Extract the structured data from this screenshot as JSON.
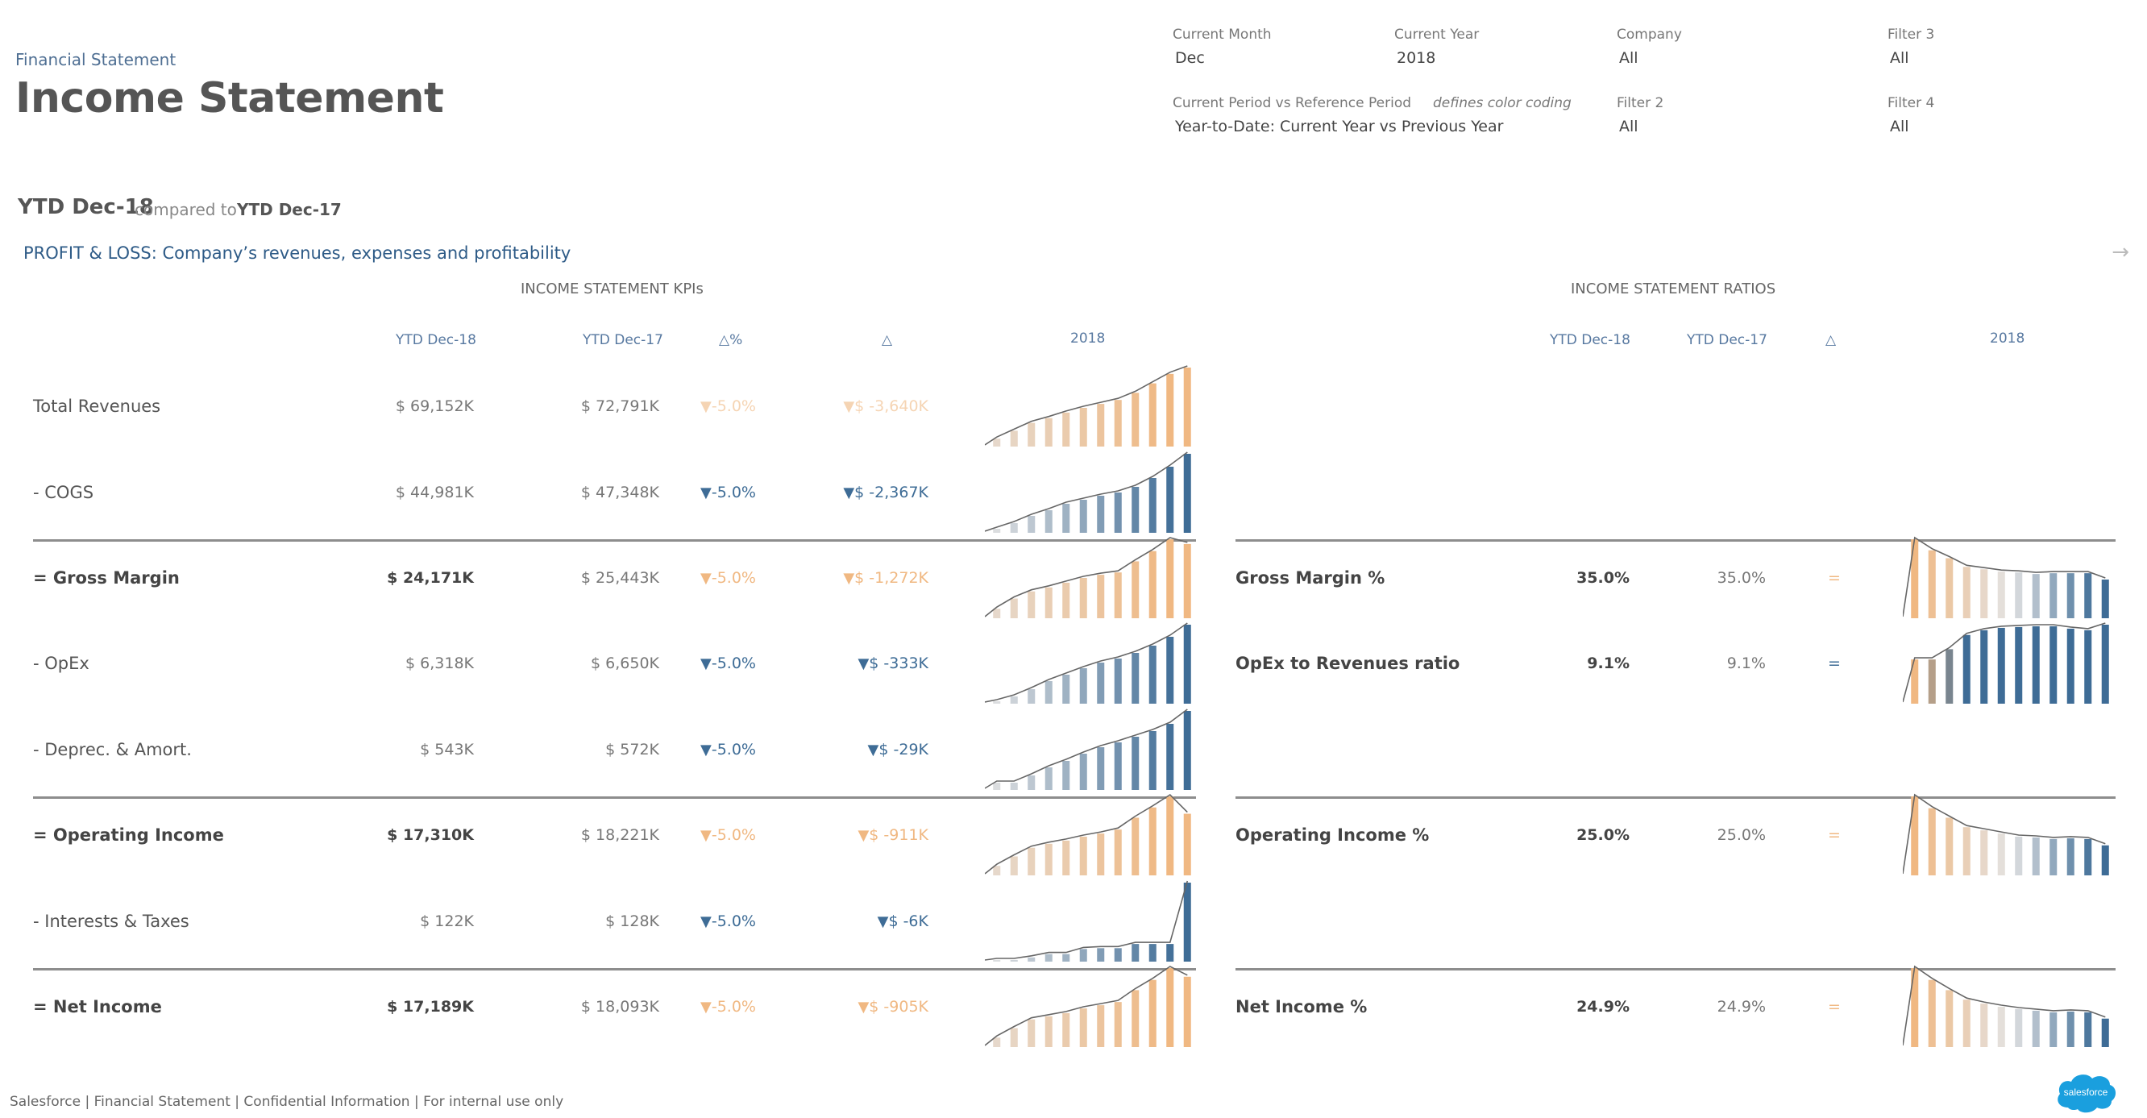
{
  "header": {
    "breadcrumb": "Financial Statement",
    "title": "Income Statement"
  },
  "filters": [
    {
      "label": "Current Month",
      "value": "Dec"
    },
    {
      "label": "Current Year",
      "value": "2018"
    },
    {
      "label": "Company",
      "value": "All"
    },
    {
      "label": "Filter 3",
      "value": "All"
    },
    {
      "label": "Current Period vs Reference Period",
      "note": "defines color coding",
      "value": "Year-to-Date: Current Year vs Previous Year"
    },
    {
      "label": "Filter 2",
      "value": "All"
    },
    {
      "label": "Filter 4",
      "value": "All"
    }
  ],
  "period": {
    "current": "YTD Dec-18",
    "compared_label": "compared to",
    "reference": "YTD Dec-17"
  },
  "section_title": "PROFIT & LOSS: Company’s revenues, expenses and profitability",
  "nav_arrow": "→",
  "kpis": {
    "title": "INCOME STATEMENT KPIs",
    "columns": [
      "YTD Dec-18",
      "YTD Dec-17",
      "△%",
      "△",
      "2018"
    ],
    "rows": [
      {
        "label": "Total Revenues",
        "bold": false,
        "cur": "$ 69,152K",
        "prev": "$ 72,791K",
        "dpct": "-5.0%",
        "dabs": "$ -3,640K",
        "color": "orange",
        "faded": true
      },
      {
        "label": "- COGS",
        "bold": false,
        "cur": "$ 44,981K",
        "prev": "$ 47,348K",
        "dpct": "-5.0%",
        "dabs": "$ -2,367K",
        "color": "blue"
      },
      {
        "label": "= Gross Margin",
        "bold": true,
        "cur": "$ 24,171K",
        "prev": "$ 25,443K",
        "dpct": "-5.0%",
        "dabs": "$ -1,272K",
        "color": "orange"
      },
      {
        "label": "- OpEx",
        "bold": false,
        "cur": "$ 6,318K",
        "prev": "$ 6,650K",
        "dpct": "-5.0%",
        "dabs": "$ -333K",
        "color": "blue"
      },
      {
        "label": "- Deprec. & Amort.",
        "bold": false,
        "cur": "$ 543K",
        "prev": "$ 572K",
        "dpct": "-5.0%",
        "dabs": "$ -29K",
        "color": "blue"
      },
      {
        "label": "= Operating Income",
        "bold": true,
        "cur": "$ 17,310K",
        "prev": "$ 18,221K",
        "dpct": "-5.0%",
        "dabs": "$ -911K",
        "color": "orange"
      },
      {
        "label": "- Interests & Taxes",
        "bold": false,
        "cur": "$ 122K",
        "prev": "$ 128K",
        "dpct": "-5.0%",
        "dabs": "$ -6K",
        "color": "blue"
      },
      {
        "label": "= Net Income",
        "bold": true,
        "cur": "$ 17,189K",
        "prev": "$ 18,093K",
        "dpct": "-5.0%",
        "dabs": "$ -905K",
        "color": "orange"
      }
    ],
    "triangle_down": "▼"
  },
  "ratios": {
    "title": "INCOME STATEMENT RATIOS",
    "columns": [
      "YTD Dec-18",
      "YTD Dec-17",
      "△",
      "2018"
    ],
    "rows": [
      {
        "row_index": 2,
        "label": "Gross Margin %",
        "cur": "35.0%",
        "prev": "35.0%",
        "delta": "=",
        "color": "orange"
      },
      {
        "row_index": 3,
        "label": "OpEx to Revenues ratio",
        "cur": "9.1%",
        "prev": "9.1%",
        "delta": "=",
        "color": "blue"
      },
      {
        "row_index": 5,
        "label": "Operating Income %",
        "cur": "25.0%",
        "prev": "25.0%",
        "delta": "=",
        "color": "orange"
      },
      {
        "row_index": 7,
        "label": "Net Income %",
        "cur": "24.9%",
        "prev": "24.9%",
        "delta": "=",
        "color": "orange"
      }
    ]
  },
  "chart_data": [
    {
      "type": "bar",
      "title": "Total Revenues 2018",
      "categories": [
        "Jan",
        "Feb",
        "Mar",
        "Apr",
        "May",
        "Jun",
        "Jul",
        "Aug",
        "Sep",
        "Oct",
        "Nov",
        "Dec"
      ],
      "values": [
        1,
        2,
        3,
        3.6,
        4.3,
        4.9,
        5.4,
        5.9,
        6.8,
        8.0,
        9.2,
        10.0
      ]
    },
    {
      "type": "bar",
      "title": "COGS 2018",
      "categories": [
        "Jan",
        "Feb",
        "Mar",
        "Apr",
        "May",
        "Jun",
        "Jul",
        "Aug",
        "Sep",
        "Oct",
        "Nov",
        "Dec"
      ],
      "values": [
        0.5,
        1.2,
        2.1,
        2.8,
        3.6,
        4.1,
        4.6,
        5.0,
        5.7,
        6.8,
        8.2,
        9.8
      ]
    },
    {
      "type": "bar",
      "title": "Gross Margin 2018",
      "categories": [
        "Jan",
        "Feb",
        "Mar",
        "Apr",
        "May",
        "Jun",
        "Jul",
        "Aug",
        "Sep",
        "Oct",
        "Nov",
        "Dec"
      ],
      "values": [
        1.2,
        2.5,
        3.4,
        3.9,
        4.5,
        5.1,
        5.5,
        5.8,
        7.2,
        8.5,
        10.0,
        9.4
      ]
    },
    {
      "type": "bar",
      "title": "OpEx 2018",
      "categories": [
        "Jan",
        "Feb",
        "Mar",
        "Apr",
        "May",
        "Jun",
        "Jul",
        "Aug",
        "Sep",
        "Oct",
        "Nov",
        "Dec"
      ],
      "values": [
        0.3,
        0.9,
        1.8,
        2.8,
        3.6,
        4.4,
        5.1,
        5.6,
        6.3,
        7.2,
        8.3,
        9.8
      ]
    },
    {
      "type": "bar",
      "title": "Deprec. & Amort. 2018",
      "categories": [
        "Jan",
        "Feb",
        "Mar",
        "Apr",
        "May",
        "Jun",
        "Jul",
        "Aug",
        "Sep",
        "Oct",
        "Nov",
        "Dec"
      ],
      "values": [
        0.9,
        0.9,
        1.8,
        2.8,
        3.6,
        4.5,
        5.3,
        5.9,
        6.6,
        7.3,
        8.2,
        9.8
      ]
    },
    {
      "type": "bar",
      "title": "Operating Income 2018",
      "categories": [
        "Jan",
        "Feb",
        "Mar",
        "Apr",
        "May",
        "Jun",
        "Jul",
        "Aug",
        "Sep",
        "Oct",
        "Nov",
        "Dec"
      ],
      "values": [
        1.2,
        2.4,
        3.5,
        4.0,
        4.4,
        4.9,
        5.3,
        5.8,
        7.3,
        8.6,
        10.0,
        7.8
      ]
    },
    {
      "type": "bar",
      "title": "Interests & Taxes 2018",
      "categories": [
        "Jan",
        "Feb",
        "Mar",
        "Apr",
        "May",
        "Jun",
        "Jul",
        "Aug",
        "Sep",
        "Oct",
        "Nov",
        "Dec"
      ],
      "values": [
        0.1,
        0.1,
        0.5,
        0.9,
        0.9,
        1.5,
        1.6,
        1.6,
        2.1,
        2.1,
        2.1,
        9.4
      ]
    },
    {
      "type": "bar",
      "title": "Net Income 2018",
      "categories": [
        "Jan",
        "Feb",
        "Mar",
        "Apr",
        "May",
        "Jun",
        "Jul",
        "Aug",
        "Sep",
        "Oct",
        "Nov",
        "Dec"
      ],
      "values": [
        1.2,
        2.4,
        3.5,
        3.9,
        4.3,
        4.9,
        5.3,
        5.7,
        7.2,
        8.5,
        10.0,
        8.9
      ]
    },
    {
      "type": "bar",
      "title": "Gross Margin % 2018",
      "categories": [
        "Jan",
        "Feb",
        "Mar",
        "Apr",
        "May",
        "Jun",
        "Jul",
        "Aug",
        "Sep",
        "Oct",
        "Nov",
        "Dec"
      ],
      "values": [
        10.0,
        8.6,
        7.6,
        6.5,
        6.2,
        5.9,
        5.8,
        5.6,
        5.7,
        5.7,
        5.7,
        4.9
      ]
    },
    {
      "type": "bar",
      "title": "OpEx to Revenues ratio 2018",
      "categories": [
        "Jan",
        "Feb",
        "Mar",
        "Apr",
        "May",
        "Jun",
        "Jul",
        "Aug",
        "Sep",
        "Oct",
        "Nov",
        "Dec"
      ],
      "values": [
        5.6,
        5.6,
        6.9,
        8.7,
        9.3,
        9.6,
        9.7,
        9.8,
        9.8,
        9.5,
        9.3,
        10.0
      ]
    },
    {
      "type": "bar",
      "title": "Operating Income % 2018",
      "categories": [
        "Jan",
        "Feb",
        "Mar",
        "Apr",
        "May",
        "Jun",
        "Jul",
        "Aug",
        "Sep",
        "Oct",
        "Nov",
        "Dec"
      ],
      "values": [
        10.0,
        8.5,
        7.3,
        6.1,
        5.7,
        5.3,
        4.9,
        4.8,
        4.6,
        4.7,
        4.6,
        3.8
      ]
    },
    {
      "type": "bar",
      "title": "Net Income % 2018",
      "categories": [
        "Jan",
        "Feb",
        "Mar",
        "Apr",
        "May",
        "Jun",
        "Jul",
        "Aug",
        "Sep",
        "Oct",
        "Nov",
        "Dec"
      ],
      "values": [
        10.0,
        8.5,
        7.2,
        6.0,
        5.5,
        5.1,
        4.8,
        4.6,
        4.4,
        4.5,
        4.4,
        3.6
      ]
    }
  ],
  "colors": {
    "orange": "#f0b882",
    "blue": "#3e6c96",
    "divider": "#8d8d8d",
    "heading_blue": "#2e5b87",
    "logo_blue": "#1a9fde"
  },
  "footer": "Salesforce | Financial Statement | Confidential Information | For internal use only",
  "logo_text": "salesforce"
}
